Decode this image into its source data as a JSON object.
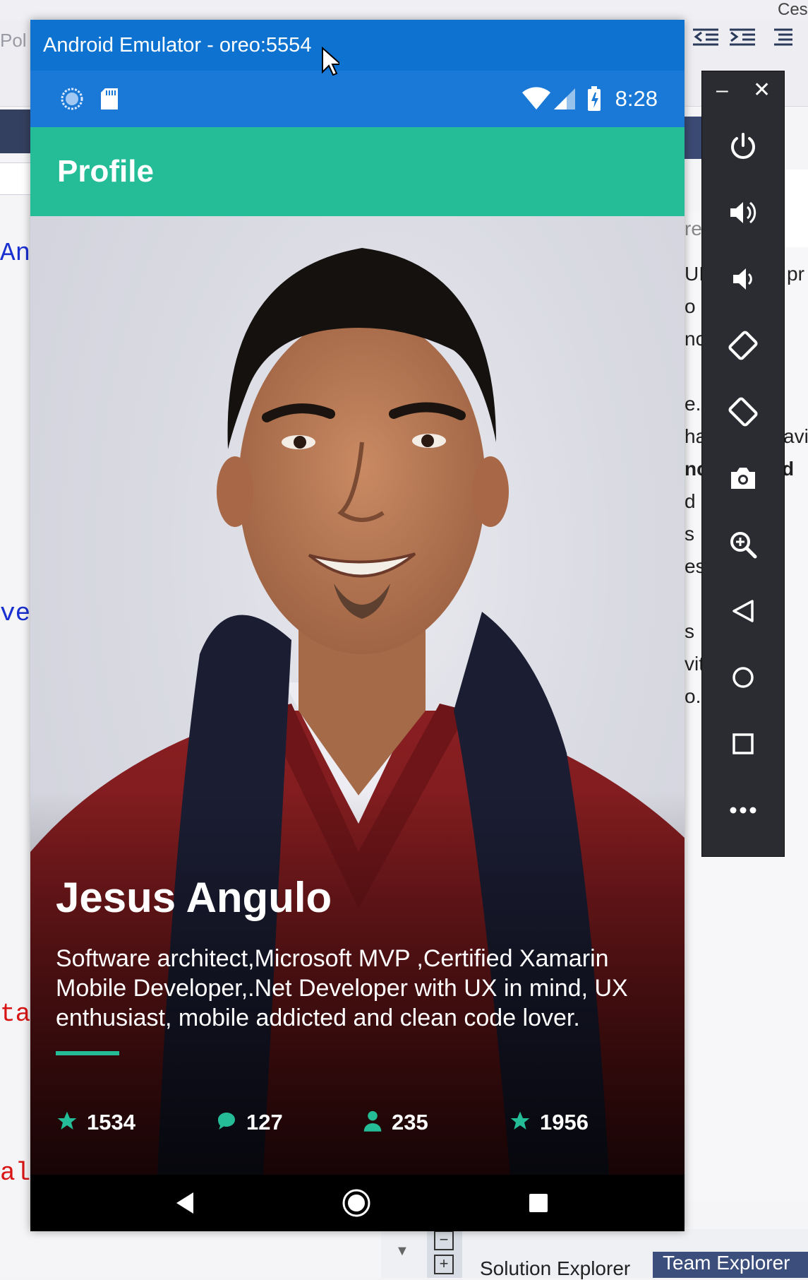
{
  "emulator": {
    "title": "Android Emulator - oreo:5554",
    "status_time": "8:28",
    "app_title": "Profile",
    "profile": {
      "name": "Jesus Angulo",
      "bio": "Software architect,Microsoft MVP ,Certified Xamarin Mobile Developer,.Net Developer with UX in mind, UX enthusiast, mobile addicted and clean code lover."
    },
    "stats": [
      {
        "icon": "star-icon",
        "value": "1534"
      },
      {
        "icon": "comment-icon",
        "value": "127"
      },
      {
        "icon": "person-icon",
        "value": "235"
      },
      {
        "icon": "star-icon",
        "value": "1956"
      }
    ],
    "accent_color": "#25bd97",
    "titlebar_color": "#0e73d0"
  },
  "side_panel": {
    "minimize": "–",
    "close": "✕",
    "buttons": [
      "power-icon",
      "volume-up-icon",
      "volume-down-icon",
      "rotate-left-icon",
      "rotate-right-icon",
      "camera-icon",
      "zoom-icon",
      "back-icon",
      "home-icon",
      "overview-icon",
      "more-icon"
    ]
  },
  "ide": {
    "toolbar_text": "Ces",
    "pol_text": "Pol",
    "code_left": [
      "And",
      "vel",
      "ta",
      "al"
    ],
    "side_fragments": [
      "re",
      "UI",
      "pr",
      "o",
      "nc",
      "e.x",
      "ha",
      "avid",
      "nc",
      "d",
      "d",
      "s",
      "es",
      "s",
      "vity",
      "o."
    ],
    "bottom_tabs": [
      "Solution Explorer",
      "Team Explorer"
    ]
  }
}
